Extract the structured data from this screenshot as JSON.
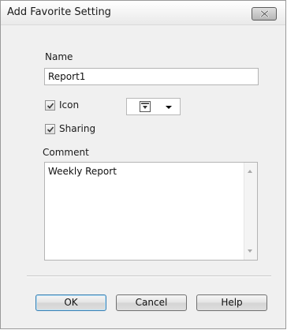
{
  "dialog": {
    "title": "Add Favorite Setting"
  },
  "form": {
    "name_label": "Name",
    "name_value": "Report1",
    "icon_label": "Icon",
    "icon_checked": true,
    "sharing_label": "Sharing",
    "sharing_checked": true,
    "comment_label": "Comment",
    "comment_value": "Weekly Report"
  },
  "buttons": {
    "ok": "OK",
    "cancel": "Cancel",
    "help": "Help"
  },
  "icons": {
    "close": "close-icon",
    "check": "checkmark-icon",
    "picker_image": "favorite-image-icon",
    "dropdown": "chevron-down-icon"
  }
}
